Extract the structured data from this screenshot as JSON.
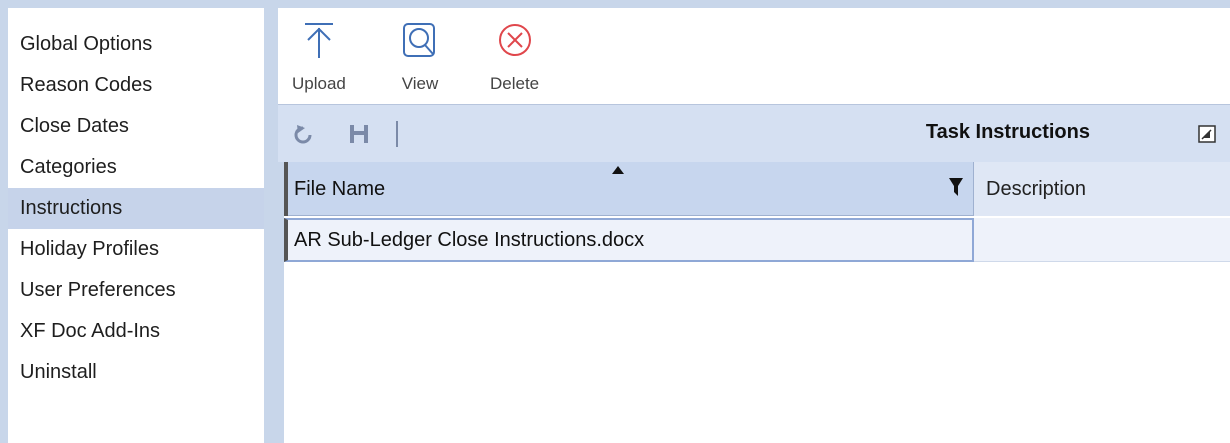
{
  "sidebar": {
    "items": [
      {
        "label": "Global Options"
      },
      {
        "label": "Reason Codes"
      },
      {
        "label": "Close Dates"
      },
      {
        "label": "Categories"
      },
      {
        "label": "Instructions"
      },
      {
        "label": "Holiday Profiles"
      },
      {
        "label": "User Preferences"
      },
      {
        "label": "XF Doc Add-Ins"
      },
      {
        "label": "Uninstall"
      }
    ],
    "selected": "Instructions"
  },
  "toolbar": {
    "upload_label": "Upload",
    "view_label": "View",
    "delete_label": "Delete",
    "upload_icon": "upload-icon",
    "view_icon": "view-icon",
    "delete_icon": "delete-icon"
  },
  "panel": {
    "title": "Task Instructions",
    "refresh_icon": "refresh-icon",
    "save_icon": "save-icon",
    "expand_icon": "expand-icon"
  },
  "grid": {
    "columns": [
      "File Name",
      "Description"
    ],
    "sort_column": "File Name",
    "sort_direction": "ascending",
    "rows": [
      {
        "file_name": "AR Sub-Ledger Close Instructions.docx",
        "description": ""
      }
    ]
  },
  "colors": {
    "accent": "#c8d6ea",
    "selected": "#c6d3ea",
    "header": "#d5e0f2",
    "icon_blue": "#3f6fb6",
    "delete_red": "#e0474c"
  }
}
